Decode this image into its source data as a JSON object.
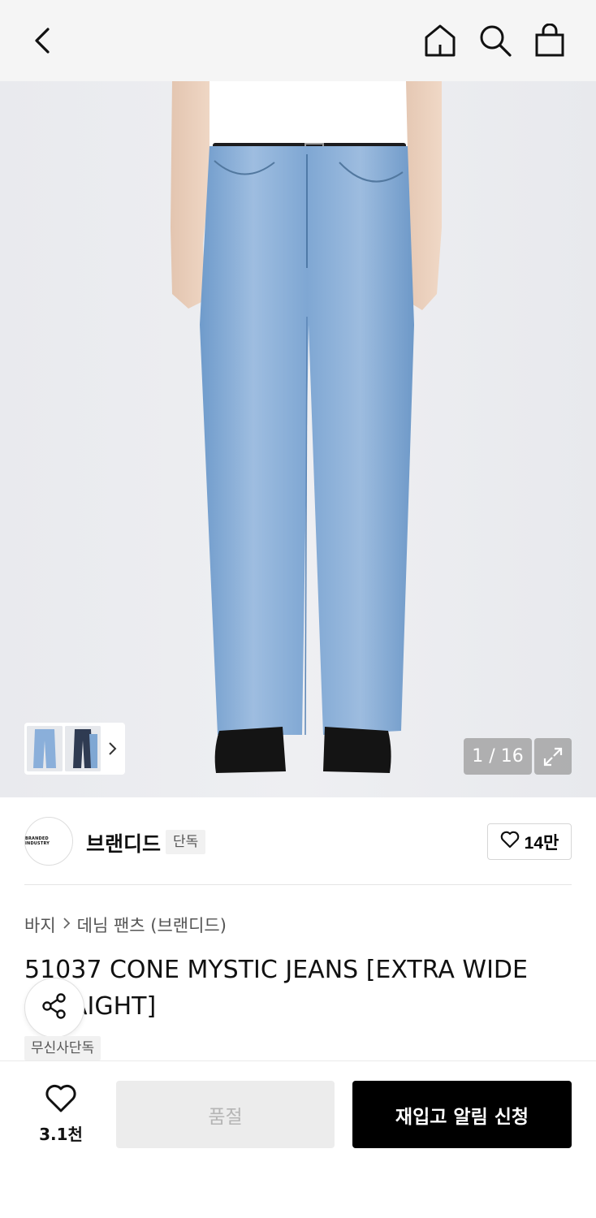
{
  "header": {
    "back_icon": "chevron-left-icon",
    "home_icon": "home-icon",
    "search_icon": "search-icon",
    "bag_icon": "shopping-bag-icon"
  },
  "gallery": {
    "counter": "1 / 16",
    "expand_icon": "expand-icon"
  },
  "brand": {
    "logo_text": "BRANDED INDUSTRY",
    "name": "브랜디드",
    "badge": "단독",
    "likes": "14만"
  },
  "breadcrumb": {
    "category": "바지",
    "subcategory": "데님 팬츠 (브랜디드)"
  },
  "product": {
    "title": "51037 CONE MYSTIC JEANS [EXTRA WIDE STRAIGHT]",
    "tag": "무신사단독"
  },
  "bottom": {
    "wish_count": "3.1천",
    "soldout_label": "품절",
    "restock_label": "재입고 알림 신청"
  },
  "colors": {
    "accent": "#000000",
    "disabled_bg": "#ececec",
    "disabled_text": "#b5b5b5",
    "denim": "#7ea6d4"
  }
}
